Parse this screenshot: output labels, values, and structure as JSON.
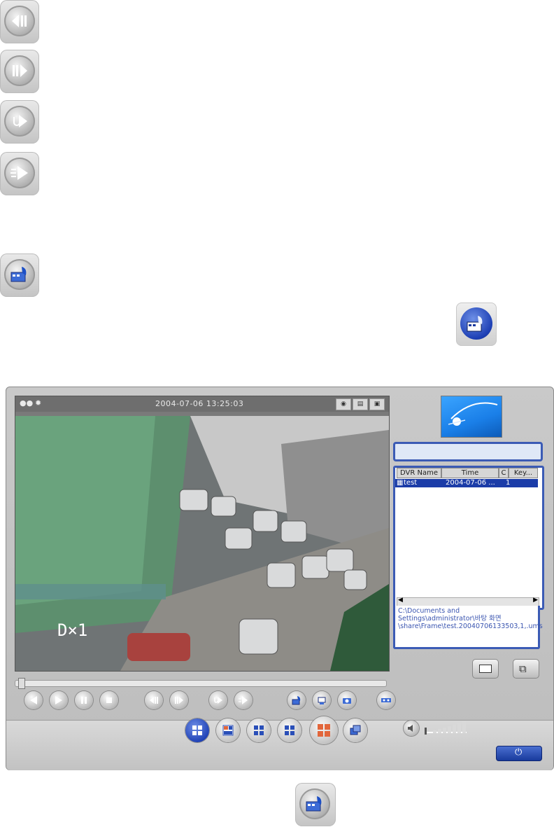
{
  "top_icons": [
    {
      "name": "step-back-icon"
    },
    {
      "name": "step-forward-icon"
    },
    {
      "name": "slow-play-icon"
    },
    {
      "name": "fast-play-icon"
    },
    {
      "name": "backup-icon"
    }
  ],
  "player": {
    "timestamp": "2004-07-06 13:25:03",
    "zoom_label": "D×1",
    "list": {
      "headers": [
        "DVR Name",
        "Time",
        "C",
        "Key..."
      ],
      "rows": [
        {
          "name": "test",
          "time": "2004-07-06 ...",
          "channel": "1"
        }
      ]
    },
    "file_path": "C:\\Documents and Settings\\administrator\\바탕 화면\\share\\Frame\\test.20040706133503,1,.ums"
  },
  "colors": {
    "accent": "#3b5bb5",
    "selection": "#1b3ca8",
    "logo": "#1a7fe8"
  }
}
